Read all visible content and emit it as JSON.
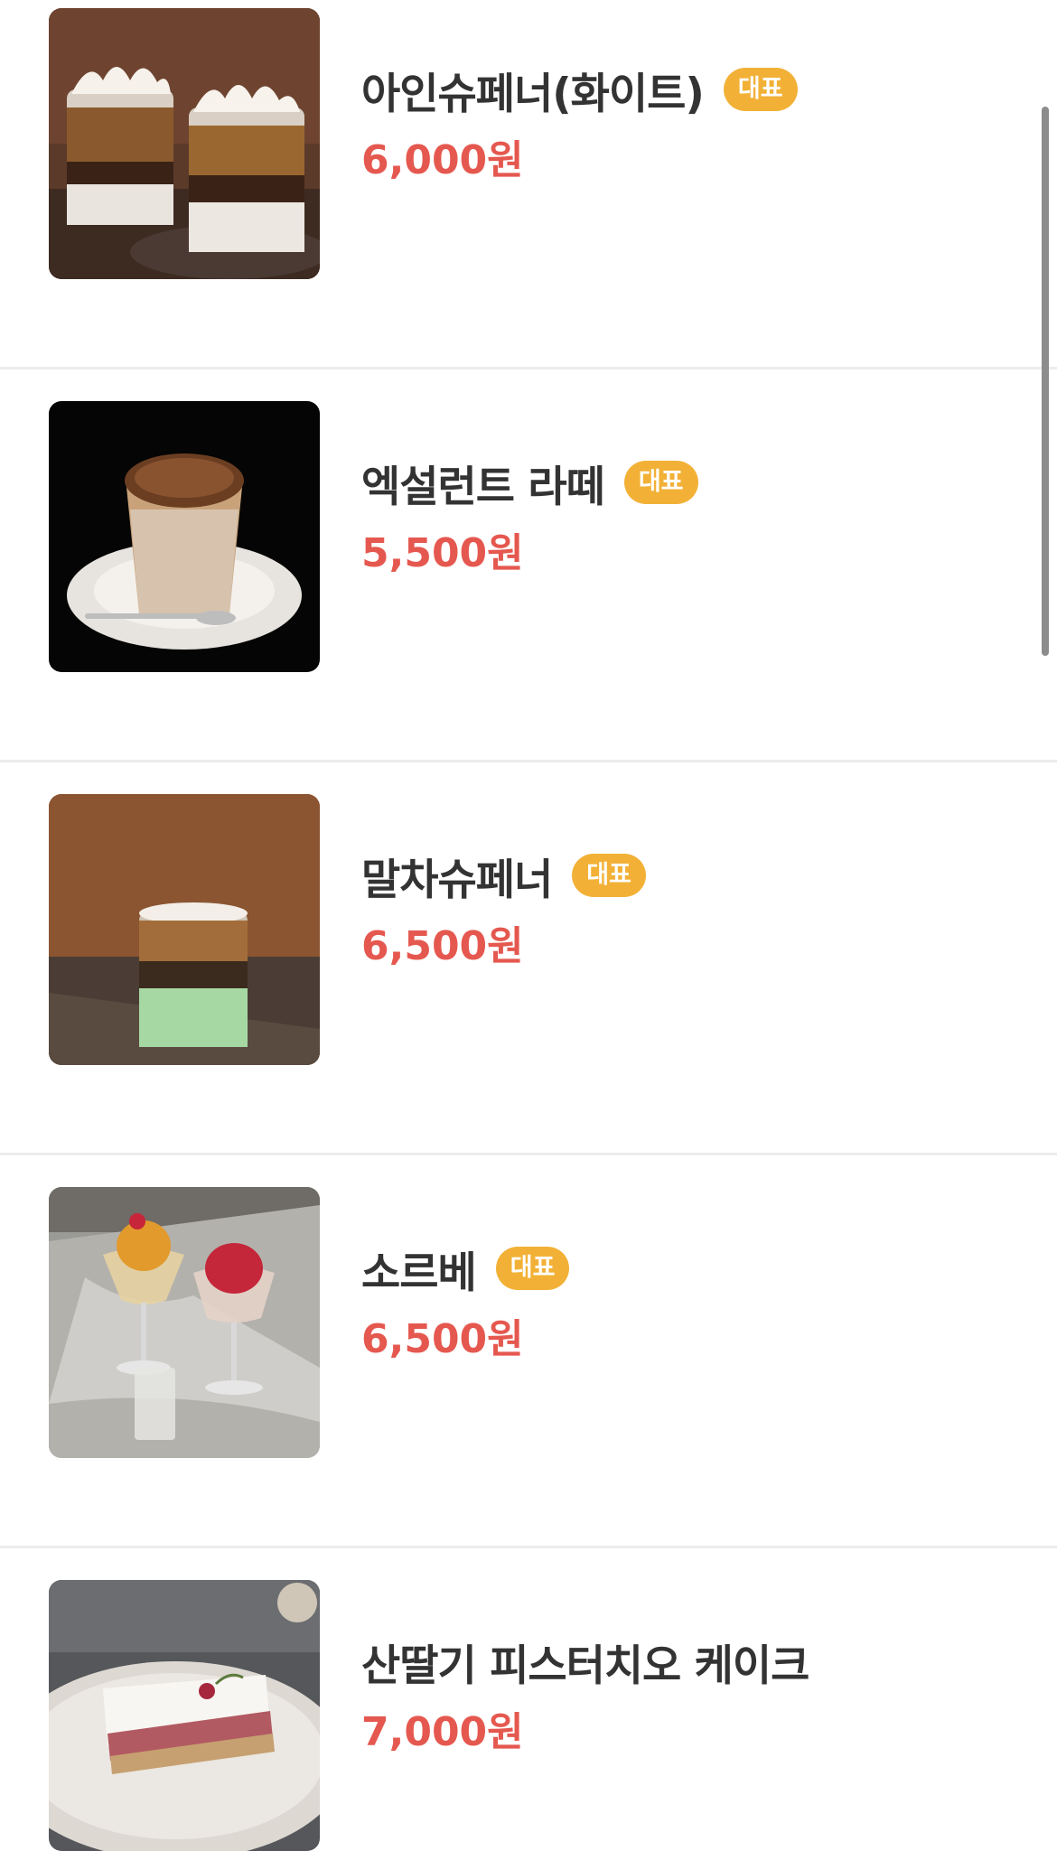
{
  "menu": {
    "items": [
      {
        "name": "아인슈페너(화이트)",
        "badge": "대표",
        "price": "6,000원",
        "image": "einspanner-white-photo"
      },
      {
        "name": "엑설런트 라떼",
        "badge": "대표",
        "price": "5,500원",
        "image": "excellent-latte-photo"
      },
      {
        "name": "말차슈페너",
        "badge": "대표",
        "price": "6,500원",
        "image": "matcha-spanner-photo"
      },
      {
        "name": "소르베",
        "badge": "대표",
        "price": "6,500원",
        "image": "sorbet-photo"
      },
      {
        "name": "산딸기 피스터치오 케이크",
        "price": "7,000원",
        "image": "raspberry-pistachio-cake-photo"
      }
    ]
  },
  "colors": {
    "price": "#e5584f",
    "badge": "#f2b136",
    "title": "#333333",
    "divider": "#ececec"
  }
}
